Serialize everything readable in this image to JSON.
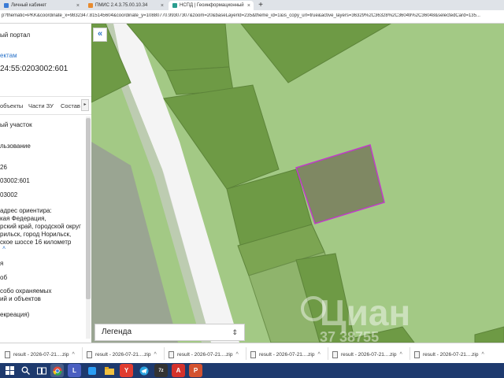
{
  "browser": {
    "tabs": [
      {
        "label": "Личный кабинет",
        "active": false
      },
      {
        "label": "ПМИС 2.4.3.75.00.10.34",
        "active": false
      },
      {
        "label": "НСПД | Геоинформационный",
        "active": true
      }
    ],
    "new_tab": "+",
    "tab_close": "×",
    "address": "p?thematic=PKK&coordinate_x=9832347.815145604&coordinate_y=10880770.99307307&zoom=20&baseLayerId=235&theme_id=1&is_copy_url=true&active_layers=36329%2C36328%2C36049%2C36048&selectedCard=135..."
  },
  "panel": {
    "portal": "ый портал",
    "objects_link": "ектам",
    "cad_number": "24:55:0203002:601",
    "tabs": [
      "объекты",
      "Части ЗУ",
      "Состав"
    ],
    "tab_more": "▸",
    "lines": [
      "ый участок",
      "льзование",
      "26",
      "03002:601",
      "03002",
      "адрес ориентира:",
      "кая Федерация,",
      "рский край, городской округ",
      "рильск, город Норильск,",
      "ское шоссе 16 километр"
    ],
    "lines2": [
      "я",
      "об",
      "собо охраняемых",
      "ий и объектов",
      "екреация)"
    ],
    "collapse": "˄"
  },
  "map": {
    "collapse_btn": "«",
    "legend": "Легенда",
    "legend_arrow": "⇕",
    "watermark": "Циан",
    "watermark_num": "37 38755",
    "colors": {
      "base": "#a3c985",
      "parcel": "#6e9a45",
      "road": "#f3f3f3",
      "selected_fill": "#7f8863",
      "selected_border": "#c03cc8"
    }
  },
  "downloads": {
    "items": [
      "result - 2026-07-21....zip",
      "result - 2026-07-21....zip",
      "result - 2026-07-21....zip",
      "result - 2026-07-21....zip",
      "result - 2026-07-21....zip",
      "result - 2026-07-21....zip"
    ],
    "menu": "^"
  },
  "taskbar": {
    "icons": [
      "windows-icon",
      "search-icon",
      "task-view-icon",
      "explorer-icon",
      "chrome-icon",
      "teams-icon",
      "app-icon",
      "yandex-icon",
      "telegram-icon",
      "archive-icon",
      "pdf-icon",
      "powerpoint-icon"
    ],
    "labels": {
      "yandex": "Y",
      "pdf": "A",
      "ppt": "P",
      "archive": "7z"
    }
  }
}
